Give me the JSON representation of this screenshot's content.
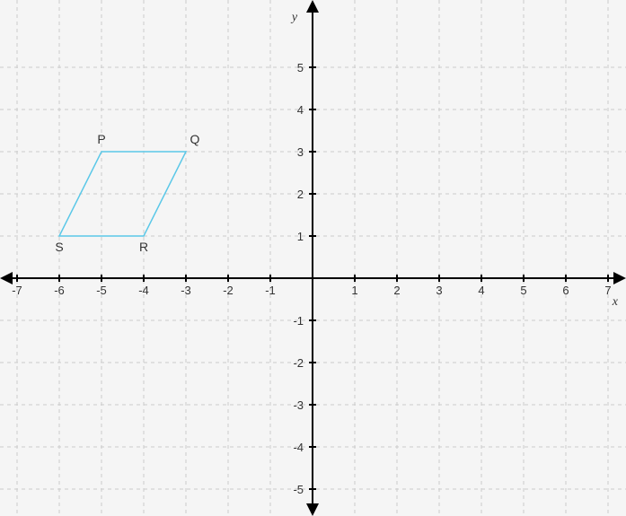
{
  "chart_data": {
    "type": "scatter",
    "title": "",
    "xlabel": "x",
    "ylabel": "y",
    "xlim": [
      -7,
      7
    ],
    "ylim": [
      -5,
      5
    ],
    "x_ticks": [
      -7,
      -6,
      -5,
      -4,
      -3,
      -2,
      -1,
      1,
      2,
      3,
      4,
      5,
      6,
      7
    ],
    "y_ticks": [
      -5,
      -4,
      -3,
      -2,
      -1,
      1,
      2,
      3,
      4,
      5
    ],
    "shape": {
      "type": "parallelogram",
      "vertices": [
        {
          "label": "P",
          "x": -5,
          "y": 3
        },
        {
          "label": "Q",
          "x": -3,
          "y": 3
        },
        {
          "label": "R",
          "x": -4,
          "y": 1
        },
        {
          "label": "S",
          "x": -6,
          "y": 1
        }
      ]
    }
  },
  "labels": {
    "x_axis": "x",
    "y_axis": "y",
    "p": "P",
    "q": "Q",
    "r": "R",
    "s": "S",
    "xt_n7": "-7",
    "xt_n6": "-6",
    "xt_n5": "-5",
    "xt_n4": "-4",
    "xt_n3": "-3",
    "xt_n2": "-2",
    "xt_n1": "-1",
    "xt_1": "1",
    "xt_2": "2",
    "xt_3": "3",
    "xt_4": "4",
    "xt_5": "5",
    "xt_6": "6",
    "xt_7": "7",
    "yt_n5": "-5",
    "yt_n4": "-4",
    "yt_n3": "-3",
    "yt_n2": "-2",
    "yt_n1": "-1",
    "yt_1": "1",
    "yt_2": "2",
    "yt_3": "3",
    "yt_4": "4",
    "yt_5": "5"
  }
}
